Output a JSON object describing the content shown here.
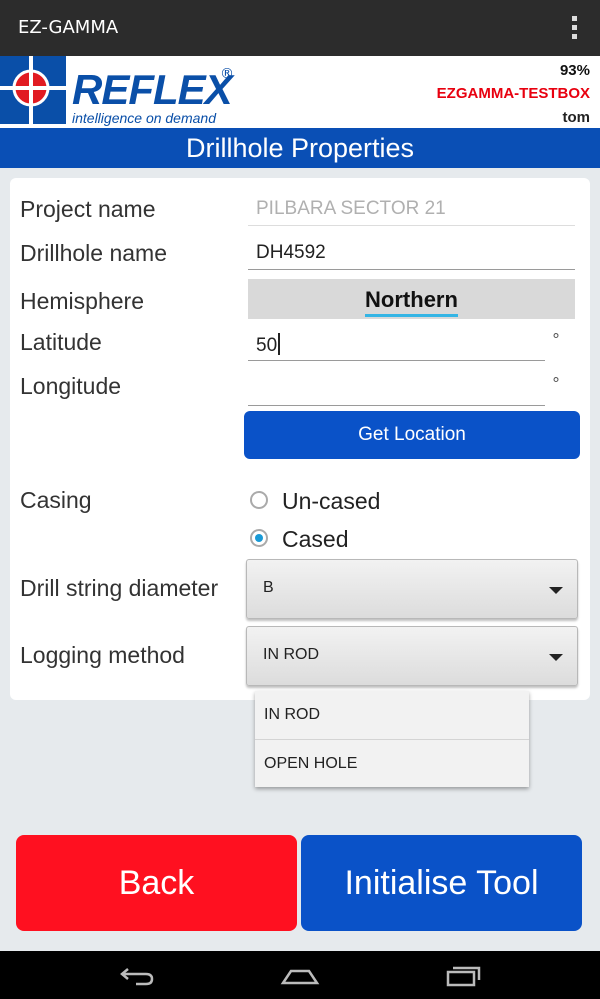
{
  "app": {
    "title": "EZ-GAMMA"
  },
  "header": {
    "brand": "REFLEX",
    "registered": "®",
    "tagline": "intelligence on demand",
    "battery": "93%",
    "device_name": "EZGAMMA-TESTBOX",
    "device_color": "#e8000f",
    "user": "tom",
    "brand_color": "#0a4fa8"
  },
  "page": {
    "title": "Drillhole Properties",
    "bar_color": "#0a4fb5"
  },
  "form": {
    "project_name": {
      "label": "Project name",
      "value": "PILBARA SECTOR 21",
      "enabled": false
    },
    "drillhole_name": {
      "label": "Drillhole name",
      "value": "DH4592"
    },
    "hemisphere": {
      "label": "Hemisphere",
      "value": "Northern"
    },
    "latitude": {
      "label": "Latitude",
      "value": "50",
      "unit": "°"
    },
    "longitude": {
      "label": "Longitude",
      "value": "",
      "unit": "°"
    },
    "get_location_label": "Get Location",
    "casing": {
      "label": "Casing",
      "options": [
        {
          "label": "Un-cased",
          "selected": false
        },
        {
          "label": "Cased",
          "selected": true
        }
      ]
    },
    "drill_string_diameter": {
      "label": "Drill string diameter",
      "value": "B"
    },
    "logging_method": {
      "label": "Logging method",
      "value": "IN ROD",
      "options": [
        "IN ROD",
        "OPEN HOLE"
      ],
      "expanded": true
    }
  },
  "buttons": {
    "back": "Back",
    "back_color": "#ff1020",
    "initialise": "Initialise Tool",
    "initialise_color": "#0a52c8"
  },
  "icons": {
    "overflow": "overflow-menu-icon",
    "logo_mark": "crosshair-logo-icon",
    "nav_back": "nav-back-icon",
    "nav_home": "nav-home-icon",
    "nav_recents": "nav-recents-icon"
  }
}
